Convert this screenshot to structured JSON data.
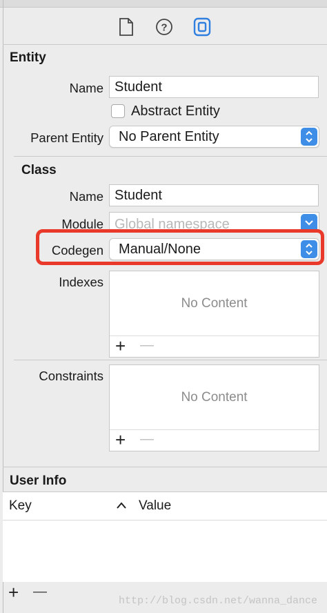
{
  "toolbar": {
    "icons": [
      "file-inspector-icon",
      "quick-help-icon",
      "data-model-inspector-icon"
    ]
  },
  "entity": {
    "section_title": "Entity",
    "name_label": "Name",
    "name_value": "Student",
    "abstract_label": "Abstract Entity",
    "abstract_checked": false,
    "parent_label": "Parent Entity",
    "parent_value": "No Parent Entity"
  },
  "class": {
    "section_title": "Class",
    "name_label": "Name",
    "name_value": "Student",
    "module_label": "Module",
    "module_placeholder": "Global namespace",
    "codegen_label": "Codegen",
    "codegen_value": "Manual/None"
  },
  "indexes": {
    "label": "Indexes",
    "empty_text": "No Content",
    "add": "+",
    "remove": "—"
  },
  "constraints": {
    "label": "Constraints",
    "empty_text": "No Content",
    "add": "+",
    "remove": "—"
  },
  "user_info": {
    "section_title": "User Info",
    "col_key": "Key",
    "sort_indicator": "^",
    "col_value": "Value",
    "add": "+",
    "remove": "—"
  },
  "watermark": "http://blog.csdn.net/wanna_dance",
  "colors": {
    "accent": "#3e8ee8",
    "highlight": "#e8392b",
    "placeholder": "#b8b8b8"
  }
}
